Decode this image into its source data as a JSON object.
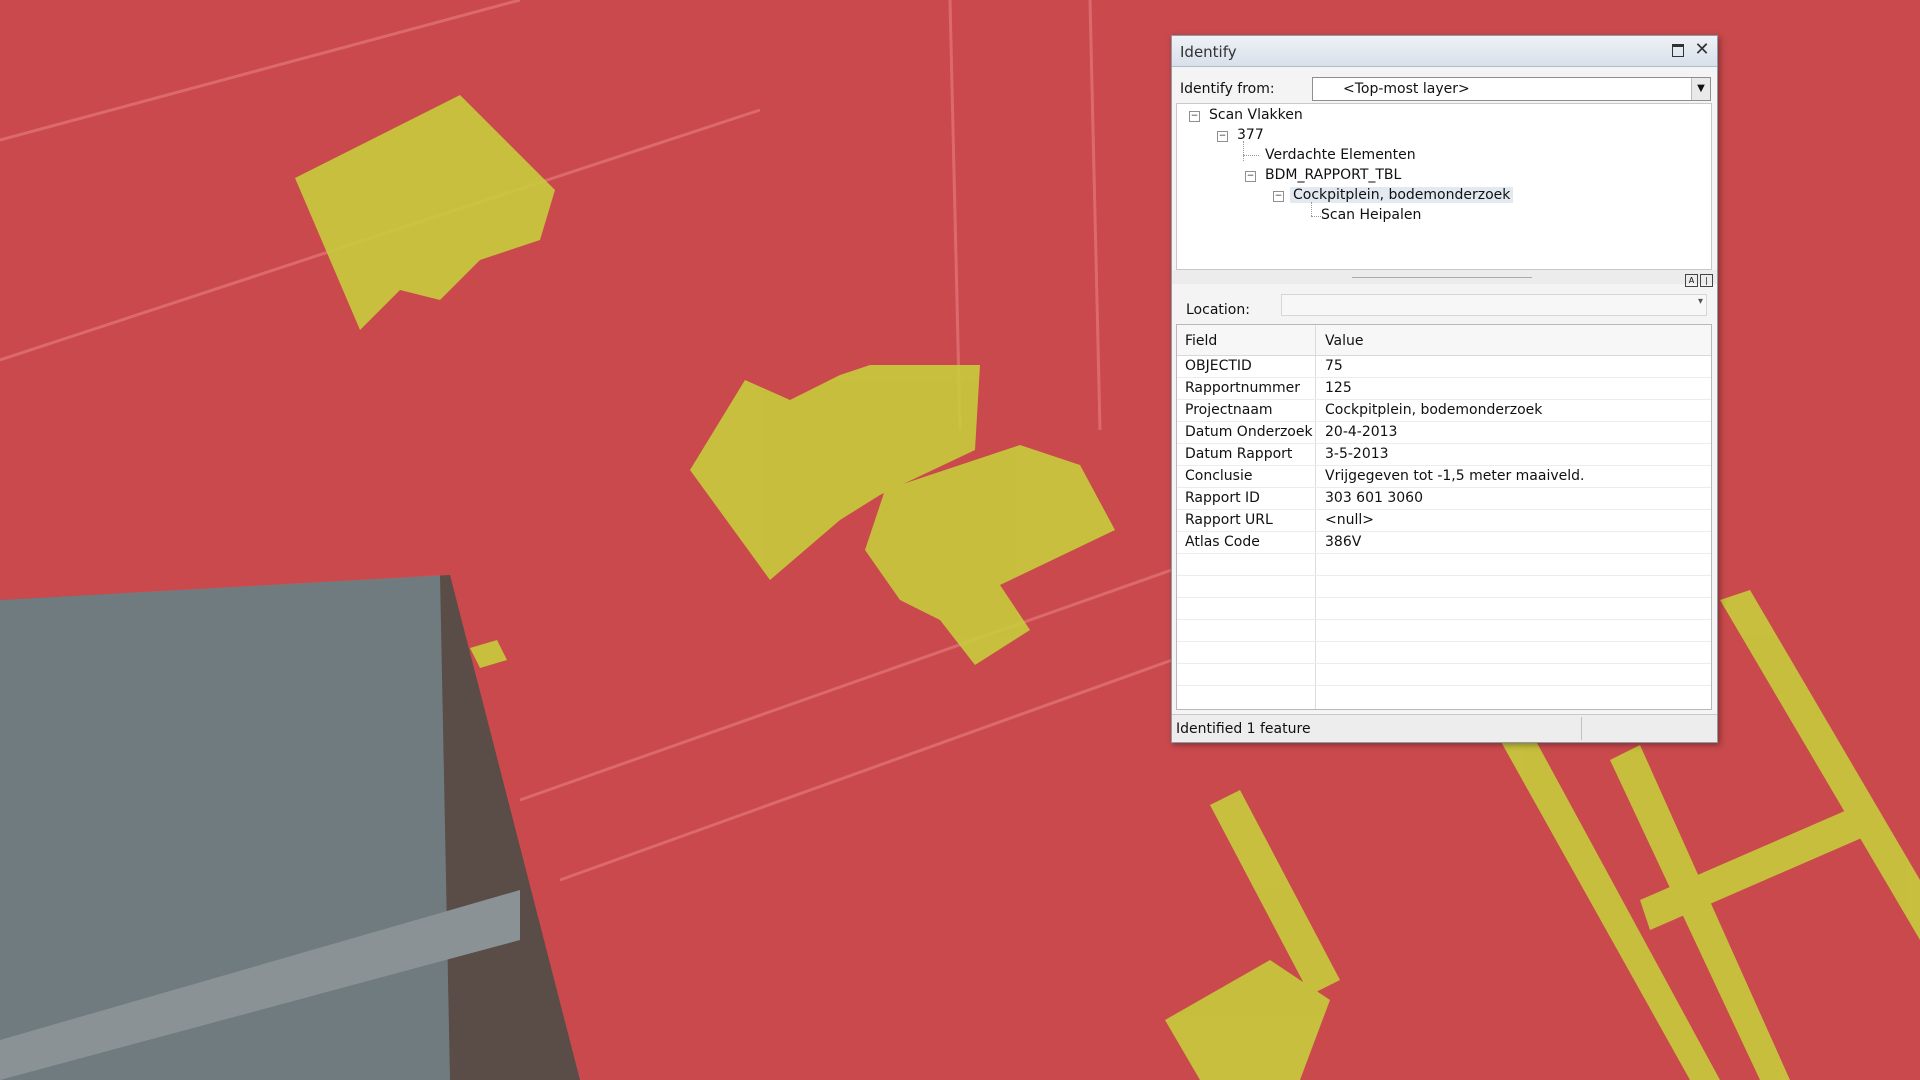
{
  "colors": {
    "zone_red": "#e2494d",
    "zone_yellow": "#c7d33b",
    "gray_area": "#6f7a80"
  },
  "identify": {
    "title": "Identify",
    "identify_from_label": "Identify from:",
    "identify_from_value": "<Top-most layer>",
    "tree": {
      "root": "Scan Vlakken",
      "id": "377",
      "child1": "Verdachte Elementen",
      "child2": "BDM_RAPPORT_TBL",
      "child3": "Cockpitplein, bodemonderzoek",
      "child4": "Scan Heipalen"
    },
    "location_label": "Location:",
    "location_value": "",
    "columns": [
      "Field",
      "Value"
    ],
    "rows": [
      {
        "field": "OBJECTID",
        "value": "75"
      },
      {
        "field": "Rapportnummer",
        "value": "125"
      },
      {
        "field": "Projectnaam",
        "value": "Cockpitplein, bodemonderzoek"
      },
      {
        "field": "Datum Onderzoek",
        "value": "20-4-2013"
      },
      {
        "field": "Datum Rapport",
        "value": "3-5-2013"
      },
      {
        "field": "Conclusie",
        "value": "Vrijgegeven tot -1,5 meter maaiveld."
      },
      {
        "field": "Rapport ID",
        "value": "303 601 3060"
      },
      {
        "field": "Rapport URL",
        "value": "<null>"
      },
      {
        "field": "Atlas Code",
        "value": "386V"
      }
    ],
    "status": "Identified 1 feature"
  }
}
